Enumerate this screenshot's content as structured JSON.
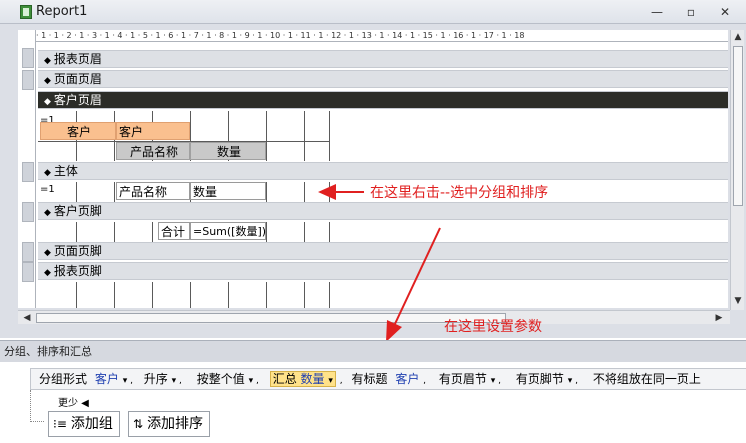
{
  "window": {
    "title": "Report1"
  },
  "ruler": {
    "marks": "· 1 · 1 · 2 · 1 · 3 · 1 · 4 · 1 · 5 · 1 · 6 · 1 · 7 · 1 · 8 · 1 · 9 · 1 · 10 · 1 · 11 · 1 · 12 · 1 · 13 · 1 · 14 · 1 · 15 · 1 · 16 · 1 · 17 · 1 · 18"
  },
  "sections": {
    "report_header": "报表页眉",
    "page_header": "页面页眉",
    "group_header": "客户页眉",
    "detail": "主体",
    "group_footer": "客户页脚",
    "page_footer": "页面页脚",
    "report_footer": "报表页脚"
  },
  "group_header_controls": {
    "eq": "=1",
    "customer_label": "客户",
    "customer_field": "客户",
    "product_label": "产品名称",
    "qty_label": "数量"
  },
  "detail_controls": {
    "eq": "=1",
    "product_field": "产品名称",
    "qty_field": "数量"
  },
  "footer_controls": {
    "total_label": "合计",
    "sum_expr": "=Sum([数量])"
  },
  "annotations": {
    "right_click": "在这里右击--选中分组和排序",
    "set_params": "在这里设置参数"
  },
  "panel": {
    "title": "分组、排序和汇总",
    "group_by": "分组形式",
    "group_field": "客户",
    "order": "升序",
    "by_value": "按整个值",
    "totals_prefix": "汇总",
    "totals_field": "数量",
    "with_title": "有标题",
    "title_value": "客户",
    "has_header": "有页眉节",
    "has_footer": "有页脚节",
    "keep_together": "不将组放在同一页上",
    "less": "更少 ◀",
    "add_group": "添加组",
    "add_sort": "添加排序"
  },
  "colors": {
    "arrow": "#e02020",
    "group_band": "#2c2d28",
    "label_fill": "#fac08f"
  }
}
